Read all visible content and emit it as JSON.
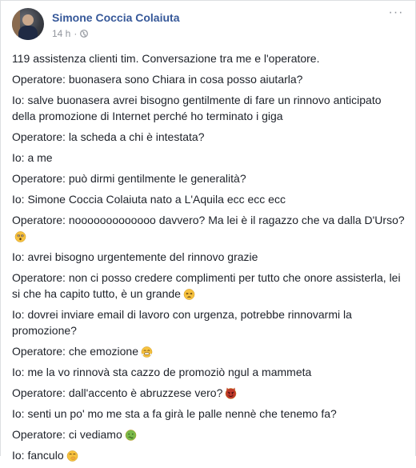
{
  "post": {
    "author": "Simone Coccia Colaiuta",
    "time": "14 h",
    "separator": "·",
    "privacy_icon": "globe-icon",
    "more_icon": "more-options-icon",
    "more_label": "···"
  },
  "messages": [
    {
      "text": "119 assistenza clienti tim. Conversazione tra me e l'operatore.",
      "emoji": ""
    },
    {
      "text": "Operatore: buonasera sono Chiara in cosa posso aiutarla?",
      "emoji": ""
    },
    {
      "text": "Io: salve buonasera avrei bisogno gentilmente di fare un rinnovo anticipato della promozione di Internet perché ho terminato i giga",
      "emoji": ""
    },
    {
      "text": "Operatore: la scheda a chi è intestata?",
      "emoji": ""
    },
    {
      "text": "Io: a me",
      "emoji": ""
    },
    {
      "text": "Operatore: può dirmi gentilmente le generalità?",
      "emoji": ""
    },
    {
      "text": "Io: Simone Coccia Colaiuta nato a L'Aquila ecc ecc ecc",
      "emoji": ""
    },
    {
      "text": "Operatore: nooooooooooooo davvero? Ma lei è il ragazzo che va dalla D'Urso?",
      "emoji": "astonished-face-icon"
    },
    {
      "text": "Io: avrei bisogno urgentemente del rinnovo grazie",
      "emoji": ""
    },
    {
      "text": "Operatore: non ci posso credere complimenti per tutto che onore assisterla, lei si che ha capito tutto, è un grande",
      "emoji": "tired-face-icon"
    },
    {
      "text": "Io: dovrei inviare email di lavoro con urgenza, potrebbe rinnovarmi la promozione?",
      "emoji": ""
    },
    {
      "text": "Operatore: che emozione",
      "emoji": "steam-face-icon"
    },
    {
      "text": "Io: me la vo rinnovà sta cazzo de promoziò ngul a mammeta",
      "emoji": ""
    },
    {
      "text": "Operatore: dall'accento è abruzzese vero?",
      "emoji": "devil-face-icon"
    },
    {
      "text": "Io: senti un po' mo me sta a fa girà le palle nennè che tenemo fa?",
      "emoji": ""
    },
    {
      "text": "Operatore: ci vediamo",
      "emoji": "nauseated-face-icon"
    },
    {
      "text": "Io: fanculo",
      "emoji": "hand-over-mouth-face-icon"
    }
  ],
  "colors": {
    "author": "#365899",
    "meta": "#90949c",
    "text": "#1d2129",
    "emoji_yellow": "#f7c23f",
    "emoji_devil": "#c0392b",
    "emoji_green": "#79b94a"
  }
}
